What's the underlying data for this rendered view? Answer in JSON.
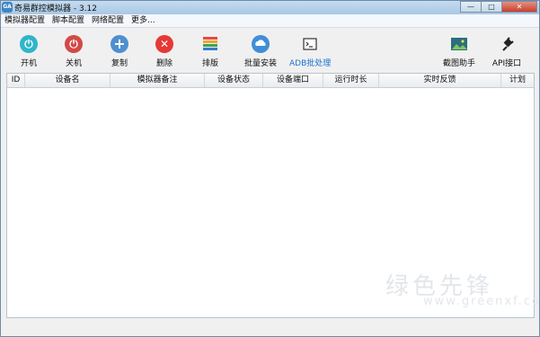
{
  "window": {
    "title": "奇易群控模拟器 - 3.12",
    "app_icon_text": "GA"
  },
  "controls": {
    "minimize": "—",
    "maximize": "□",
    "close": "✕"
  },
  "menu": [
    "模拟器配置",
    "脚本配置",
    "网络配置",
    "更多..."
  ],
  "toolbar": {
    "power_on": "开机",
    "power_off": "关机",
    "copy": "复制",
    "delete": "删除",
    "arrange": "排版",
    "batch_install": "批量安装",
    "adb_batch": "ADB批处理",
    "screenshot_helper": "截图助手",
    "api": "API接口"
  },
  "table": {
    "columns": [
      "ID",
      "设备名",
      "模拟器备注",
      "设备状态",
      "设备端口",
      "运行时长",
      "实时反馈",
      "计划"
    ]
  },
  "watermark": {
    "main": "绿色先锋",
    "sub": "www.greenxf.com"
  },
  "colors": {
    "power_on": "#2fb5c9",
    "power_off": "#d24a45",
    "copy": "#4f8fd0",
    "delete": "#e53935",
    "accent_link": "#1d72d2"
  }
}
